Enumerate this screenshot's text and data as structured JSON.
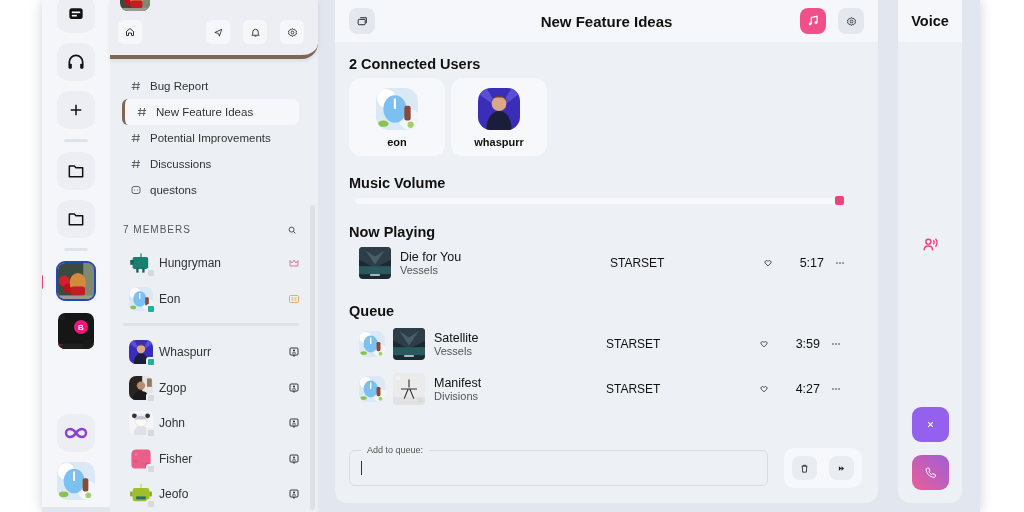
{
  "rail": {
    "servers": [
      {
        "selected": true
      },
      {
        "selected": false,
        "badge": "B"
      }
    ]
  },
  "sidebar": {
    "channels": [
      {
        "name": "Bug Report",
        "kind": "text",
        "selected": false
      },
      {
        "name": "New Feature Ideas",
        "kind": "text",
        "selected": true
      },
      {
        "name": "Potential Improvements",
        "kind": "text",
        "selected": false
      },
      {
        "name": "Discussions",
        "kind": "text",
        "selected": false
      },
      {
        "name": "questons",
        "kind": "forum",
        "selected": false
      }
    ],
    "members_title": "7 MEMBERS",
    "member_groups": [
      [
        {
          "name": "Hungryman",
          "online": false,
          "kind": "owner"
        },
        {
          "name": "Eon",
          "online": true,
          "kind": "moderator"
        }
      ],
      [
        {
          "name": "Whaspurr",
          "online": true,
          "kind": "member"
        },
        {
          "name": "Zgop",
          "online": false,
          "kind": "member"
        },
        {
          "name": "John",
          "online": false,
          "kind": "member"
        },
        {
          "name": "Fisher",
          "online": false,
          "kind": "member"
        },
        {
          "name": "Jeofo",
          "online": false,
          "kind": "member"
        }
      ]
    ]
  },
  "main": {
    "title": "New Feature Ideas",
    "music_on": true,
    "connected_title": "2 Connected Users",
    "connected_users": [
      {
        "name": "eon"
      },
      {
        "name": "whaspurr"
      }
    ],
    "volume": {
      "title": "Music Volume",
      "level": 0.99
    },
    "now_playing": {
      "title": "Now Playing",
      "track": {
        "title": "Die for You",
        "album": "Vessels",
        "artist": "STARSET",
        "duration": "5:17"
      }
    },
    "queue": {
      "title": "Queue",
      "tracks": [
        {
          "title": "Satellite",
          "album": "Vessels",
          "artist": "STARSET",
          "duration": "3:59"
        },
        {
          "title": "Manifest",
          "album": "Divisions",
          "artist": "STARSET",
          "duration": "4:27"
        }
      ]
    },
    "add_field": {
      "label": "Add to queue:"
    }
  },
  "voice": {
    "title": "Voice"
  }
}
